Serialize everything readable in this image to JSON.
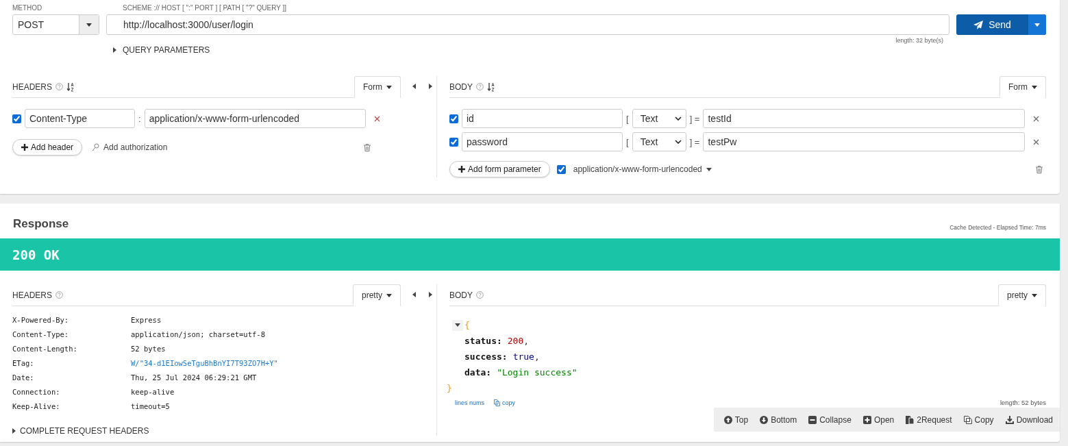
{
  "request": {
    "method_label": "METHOD",
    "url_label": "SCHEME :// HOST [ \":\" PORT ] [ PATH [ \"?\" QUERY ]]",
    "method": "POST",
    "url": "http://localhost:3000/user/login",
    "send": "Send",
    "length": "length: 32 byte(s)",
    "query_parameters": "QUERY PARAMETERS"
  },
  "request_headers": {
    "title": "HEADERS",
    "mode": "Form",
    "rows": [
      {
        "checked": true,
        "name": "Content-Type",
        "separator": ":",
        "value": "application/x-www-form-urlencoded"
      }
    ],
    "add": "Add header",
    "auth": "Add authorization"
  },
  "request_body": {
    "title": "BODY",
    "mode": "Form",
    "rows": [
      {
        "checked": true,
        "name": "id",
        "open": "[",
        "type": "Text",
        "close": "] =",
        "value": "testId"
      },
      {
        "checked": true,
        "name": "password",
        "open": "[",
        "type": "Text",
        "close": "] =",
        "value": "testPw"
      }
    ],
    "add": "Add form parameter",
    "content_type": {
      "checked": true,
      "label": "application/x-www-form-urlencoded"
    }
  },
  "response": {
    "title": "Response",
    "timing": "Cache Detected - Elapsed Time: 7ms",
    "status": "200 OK",
    "headers": {
      "title": "HEADERS",
      "mode": "pretty",
      "rows": [
        {
          "name": "X-Powered-By:",
          "value": "Express",
          "kind": "text"
        },
        {
          "name": "Content-Type:",
          "value": "application/json; charset=utf-8",
          "kind": "text"
        },
        {
          "name": "Content-Length:",
          "value": "52 bytes",
          "kind": "text"
        },
        {
          "name": "ETag:",
          "value": "W/\"34-d1EIowSeTguBhBnYI7T93ZO7H+Y\"",
          "kind": "link"
        },
        {
          "name": "Date:",
          "value": "Thu, 25 Jul 2024 06:29:21 GMT",
          "kind": "text"
        },
        {
          "name": "Connection:",
          "value": "keep-alive",
          "kind": "text"
        },
        {
          "name": "Keep-Alive:",
          "value": "timeout=5",
          "kind": "text"
        }
      ],
      "complete": "COMPLETE REQUEST HEADERS"
    },
    "body": {
      "title": "BODY",
      "mode": "pretty",
      "open": "{",
      "close": "}",
      "fields": [
        {
          "key": "status:",
          "value": "200",
          "kind": "number",
          "suffix": ","
        },
        {
          "key": "success:",
          "value": "true",
          "kind": "boolean",
          "suffix": ","
        },
        {
          "key": "data:",
          "value": "\"Login success\"",
          "kind": "string"
        }
      ],
      "lines_nums": "lines nums",
      "copy": "copy",
      "length": "length: 52 bytes"
    },
    "toolbar": [
      {
        "kind": "up",
        "label": "Top"
      },
      {
        "kind": "down",
        "label": "Bottom"
      },
      {
        "kind": "minus",
        "label": "Collapse"
      },
      {
        "kind": "plus",
        "label": "Open"
      },
      {
        "kind": "docs",
        "label": "2Request"
      },
      {
        "kind": "copy",
        "label": "Copy"
      },
      {
        "kind": "download",
        "label": "Download"
      }
    ]
  }
}
